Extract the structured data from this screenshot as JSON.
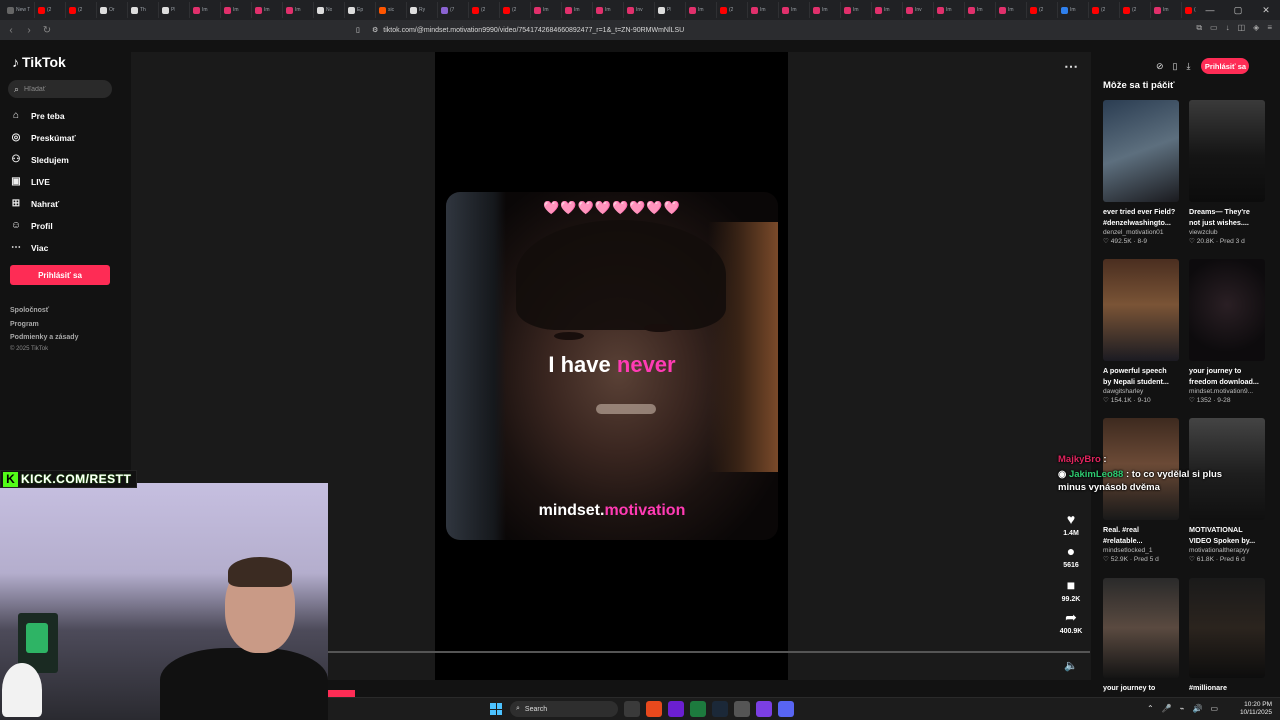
{
  "browser": {
    "tabs": [
      "New T",
      "(2",
      "(2",
      "Or",
      "Th",
      "Pl",
      "Im",
      "Im",
      "Im",
      "Im",
      "No",
      "Ep",
      "sic",
      "Ry",
      "(7",
      "(2",
      "(2",
      "Im",
      "Im",
      "Im",
      "Inv",
      "Pl",
      "Im",
      "(2",
      "Im",
      "Im",
      "Im",
      "Im",
      "Im",
      "Inv",
      "Im",
      "Im",
      "Im",
      "(2",
      "Im",
      "(2",
      "(2",
      "Im",
      "(2"
    ],
    "new_tab": "+",
    "url": "tiktok.com/@mindset.motivation9990/video/7541742684660892477_r=1&_t=ZN-90RMWmNlLSU"
  },
  "sidebar": {
    "logo": "TikTok",
    "search_placeholder": "Hľadať",
    "nav": [
      {
        "label": "Pre teba",
        "icon": "home-icon"
      },
      {
        "label": "Preskúmať",
        "icon": "compass-icon"
      },
      {
        "label": "Sledujem",
        "icon": "following-icon"
      },
      {
        "label": "LIVE",
        "icon": "live-icon"
      },
      {
        "label": "Nahrať",
        "icon": "upload-icon"
      },
      {
        "label": "Profil",
        "icon": "profile-icon"
      },
      {
        "label": "Viac",
        "icon": "more-dots-icon"
      }
    ],
    "login": "Prihlásiť sa",
    "footer": [
      "Spoločnosť",
      "Program",
      "Podmienky a zásady"
    ],
    "copyright": "© 2025 TikTok"
  },
  "video": {
    "hearts": "🩷🩷🩷🩷🩷🩷🩷🩷",
    "caption_white": "I have",
    "caption_highlight": "never",
    "brand_white": "mindset.",
    "brand_highlight": "motivation",
    "actions": [
      {
        "icon": "heart-icon",
        "count": "1.4M"
      },
      {
        "icon": "comment-icon",
        "count": "5616"
      },
      {
        "icon": "bookmark-icon",
        "count": "99.2K"
      },
      {
        "icon": "share-icon",
        "count": "400.9K"
      }
    ]
  },
  "right_panel": {
    "login": "Prihlásiť sa",
    "heading": "Môže sa ti páčiť",
    "cards": [
      {
        "title": "ever tried ever Field?",
        "title2": "#denzelwashingto...",
        "author": "denzel_motivation01",
        "likes": "492.5K",
        "date": "8-9"
      },
      {
        "title": "Dreams— They're",
        "title2": "not just wishes....",
        "author": "viewzclub",
        "likes": "20.8K",
        "date": "Pred 3 d"
      },
      {
        "title": "A powerful speech",
        "title2": "by Nepali student...",
        "author": "dawgitsharley",
        "likes": "154.1K",
        "date": "9-10"
      },
      {
        "title": "your journey to",
        "title2": "freedom download...",
        "author": "mindset.motivation9...",
        "likes": "1352",
        "date": "9-28"
      },
      {
        "title": "Real. #real",
        "title2": "#relatable...",
        "author": "mindsetlocked_1",
        "likes": "52.9K",
        "date": "Pred 5 d"
      },
      {
        "title": "MOTIVATIONAL",
        "title2": "VIDEO Spoken by...",
        "author": "motivationaltherapyy",
        "likes": "61.8K",
        "date": "Pred 6 d"
      },
      {
        "title": "your journey to",
        "title2": "",
        "author": "",
        "likes": "",
        "date": ""
      },
      {
        "title": "#millionare",
        "title2": "",
        "author": "",
        "likes": "",
        "date": ""
      }
    ]
  },
  "chat": [
    {
      "user": "MajkyBro",
      "text": ":"
    },
    {
      "user": "JakimLeo88",
      "text": ": to co vydělal si plus minus vynásob dvěma"
    }
  ],
  "stream": {
    "kick_label": "KICK.COM/RESTT"
  },
  "taskbar": {
    "search": "Search",
    "time": "10:20 PM",
    "date": "10/11/2025"
  }
}
